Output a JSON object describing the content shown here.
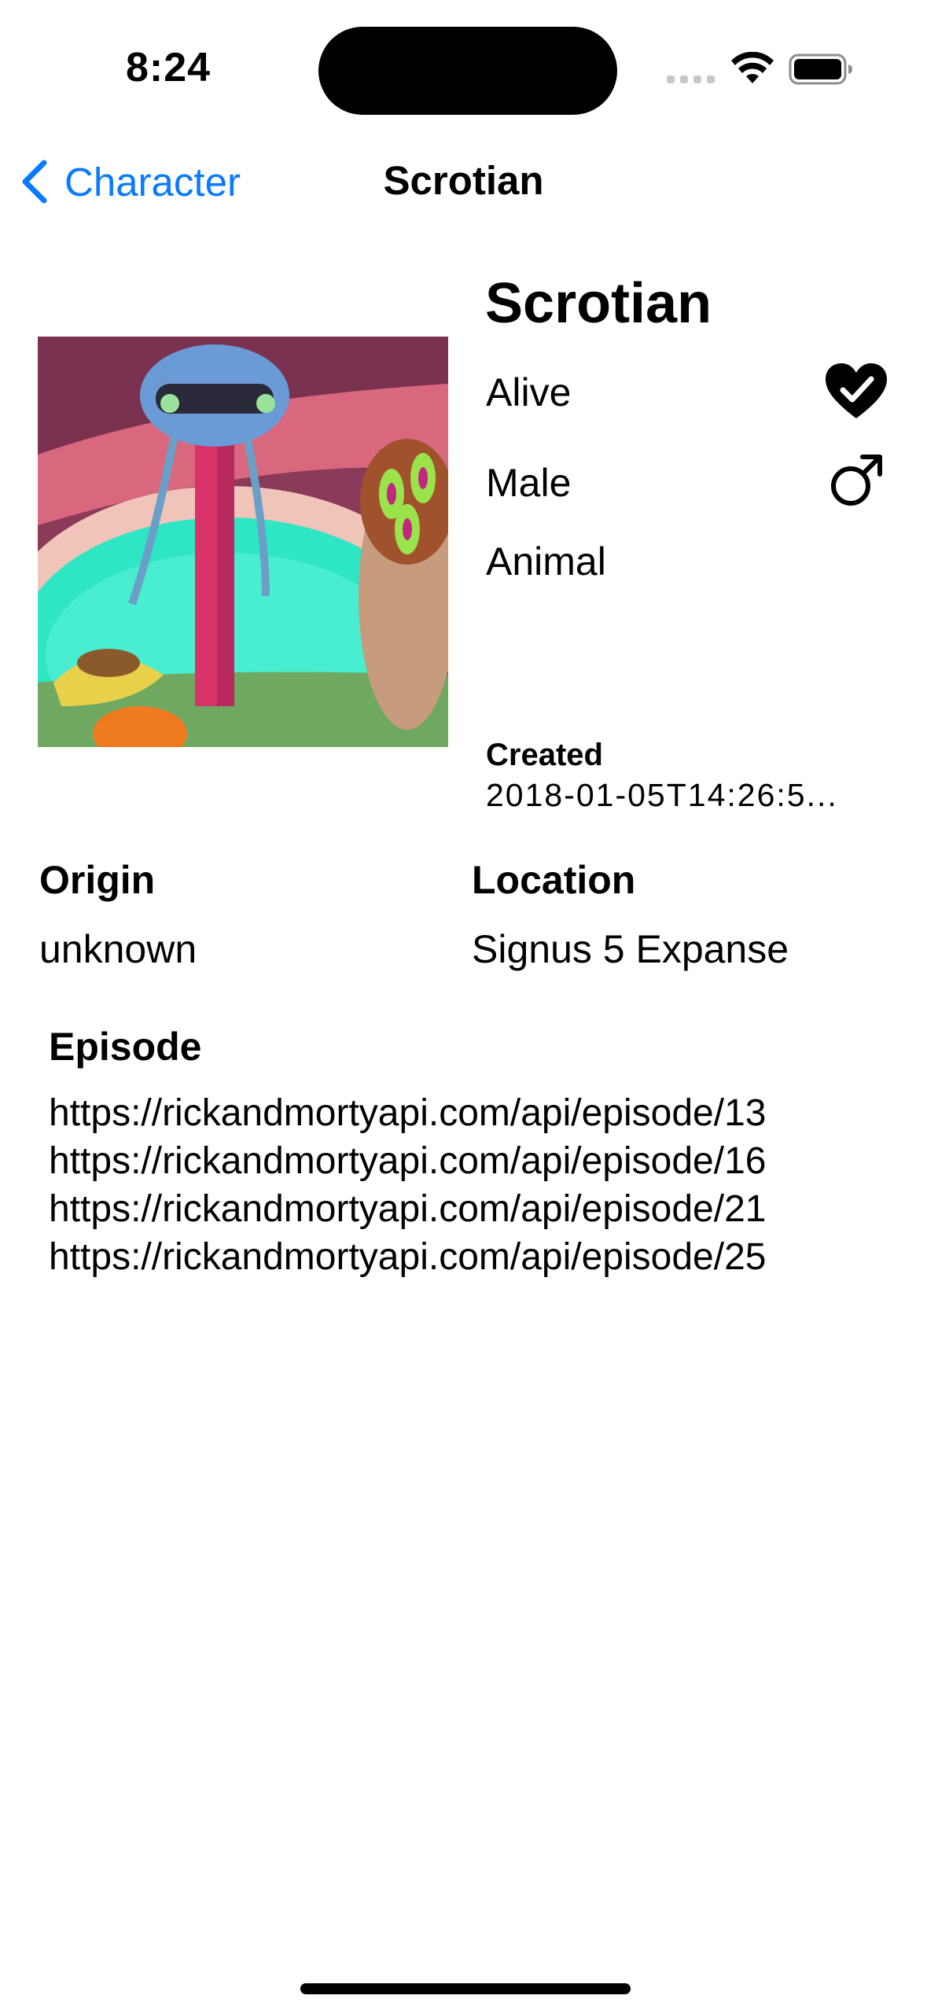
{
  "status_bar": {
    "time": "8:24"
  },
  "nav": {
    "back_label": "Character",
    "title": "Scrotian"
  },
  "character": {
    "name": "Scrotian",
    "status": "Alive",
    "gender": "Male",
    "species": "Animal",
    "created_label": "Created",
    "created_value": "2018-01-05T14:26:5..."
  },
  "origin": {
    "label": "Origin",
    "value": "unknown"
  },
  "location": {
    "label": "Location",
    "value": "Signus 5 Expanse"
  },
  "episodes": {
    "label": "Episode",
    "items": [
      "https://rickandmortyapi.com/api/episode/13",
      "https://rickandmortyapi.com/api/episode/16",
      "https://rickandmortyapi.com/api/episode/21",
      "https://rickandmortyapi.com/api/episode/25"
    ]
  },
  "icons": {
    "status": "heart-checkmark-icon",
    "gender": "male-symbol-icon",
    "back": "chevron-left-icon"
  },
  "colors": {
    "accent": "#0a7aff",
    "text": "#000000",
    "background": "#ffffff"
  }
}
